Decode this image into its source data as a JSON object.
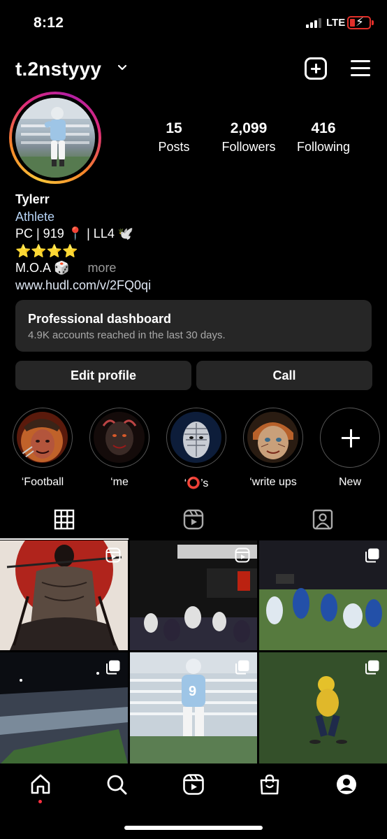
{
  "status_bar": {
    "time": "8:12",
    "network": "LTE",
    "battery_color": "#e2302a"
  },
  "header": {
    "username": "t.2nstyyy",
    "new_post_icon": "plus-square-icon",
    "menu_icon": "hamburger-menu-icon"
  },
  "stats": [
    {
      "value": "15",
      "label": "Posts"
    },
    {
      "value": "2,099",
      "label": "Followers"
    },
    {
      "value": "416",
      "label": "Following"
    }
  ],
  "bio": {
    "name": "Tylerr",
    "category": "Athlete",
    "line1": "PC | 919 📍 | LL4 🕊️",
    "line2": "⭐⭐⭐⭐",
    "line3": "M.O.A 🎲",
    "more": "more",
    "link": "www.hudl.com/v/2FQ0qi"
  },
  "dashboard": {
    "title": "Professional dashboard",
    "subtitle": "4.9K accounts reached in the last 30 days."
  },
  "buttons": {
    "edit_profile": "Edit profile",
    "call": "Call"
  },
  "highlights": [
    {
      "label": "‘Football"
    },
    {
      "label": "‘me"
    },
    {
      "label": "‘⭕’s"
    },
    {
      "label": "‘write ups"
    },
    {
      "label": "New"
    }
  ],
  "tabs": [
    "grid-icon",
    "reels-icon",
    "tagged-icon"
  ],
  "grid_badges": [
    "reel-icon",
    "reel-icon",
    "carousel-icon",
    "carousel-icon",
    "carousel-icon",
    "carousel-icon"
  ],
  "nav": [
    "home-icon",
    "search-icon",
    "reels-icon",
    "shop-icon",
    "profile-icon"
  ],
  "colors": {
    "background": "#000000",
    "surface": "#262626",
    "link": "#b6d3f5",
    "notification": "#ff3040"
  }
}
